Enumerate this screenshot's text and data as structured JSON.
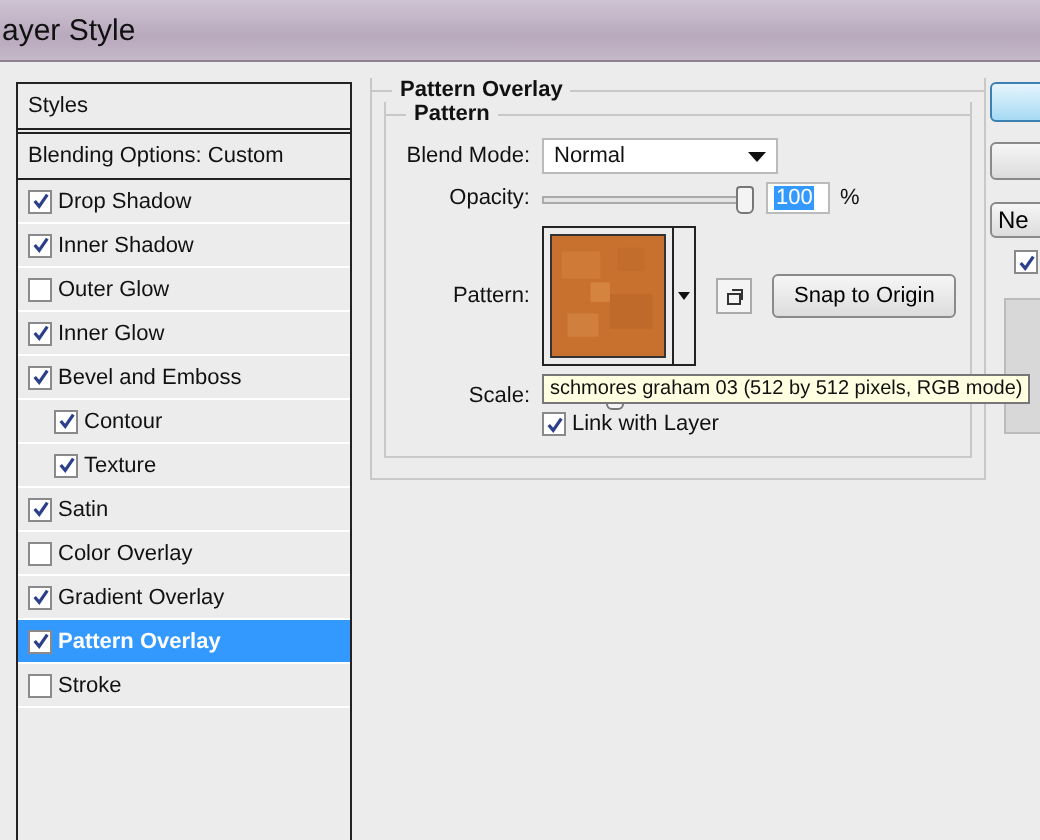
{
  "window": {
    "title": "ayer Style"
  },
  "styles_panel": {
    "header": "Styles",
    "blending_options": "Blending Options: Custom",
    "items": [
      {
        "label": "Drop Shadow",
        "checked": true,
        "selected": false
      },
      {
        "label": "Inner Shadow",
        "checked": true,
        "selected": false
      },
      {
        "label": "Outer Glow",
        "checked": false,
        "selected": false
      },
      {
        "label": "Inner Glow",
        "checked": true,
        "selected": false
      },
      {
        "label": "Bevel and Emboss",
        "checked": true,
        "selected": false,
        "children": [
          {
            "label": "Contour",
            "checked": true,
            "selected": false
          },
          {
            "label": "Texture",
            "checked": true,
            "selected": false
          }
        ]
      },
      {
        "label": "Satin",
        "checked": true,
        "selected": false
      },
      {
        "label": "Color Overlay",
        "checked": false,
        "selected": false
      },
      {
        "label": "Gradient Overlay",
        "checked": true,
        "selected": false
      },
      {
        "label": "Pattern Overlay",
        "checked": true,
        "selected": true
      },
      {
        "label": "Stroke",
        "checked": false,
        "selected": false
      }
    ]
  },
  "pattern_overlay": {
    "title": "Pattern Overlay",
    "group": "Pattern",
    "blend_mode": {
      "label": "Blend Mode:",
      "value": "Normal"
    },
    "opacity": {
      "label": "Opacity:",
      "level": 0.97,
      "value": "100",
      "unit": "%"
    },
    "pattern": {
      "label": "Pattern:",
      "snap_button": "Snap to Origin"
    },
    "scale": {
      "label": "Scale:",
      "level": 0.35
    },
    "link_with_layer": {
      "label": "Link with Layer",
      "checked": true
    },
    "tooltip": "schmores graham 03 (512 by 512 pixels, RGB mode)"
  },
  "side_buttons": {
    "new_button": "Ne",
    "preview_checkbox": {
      "checked": true
    }
  }
}
